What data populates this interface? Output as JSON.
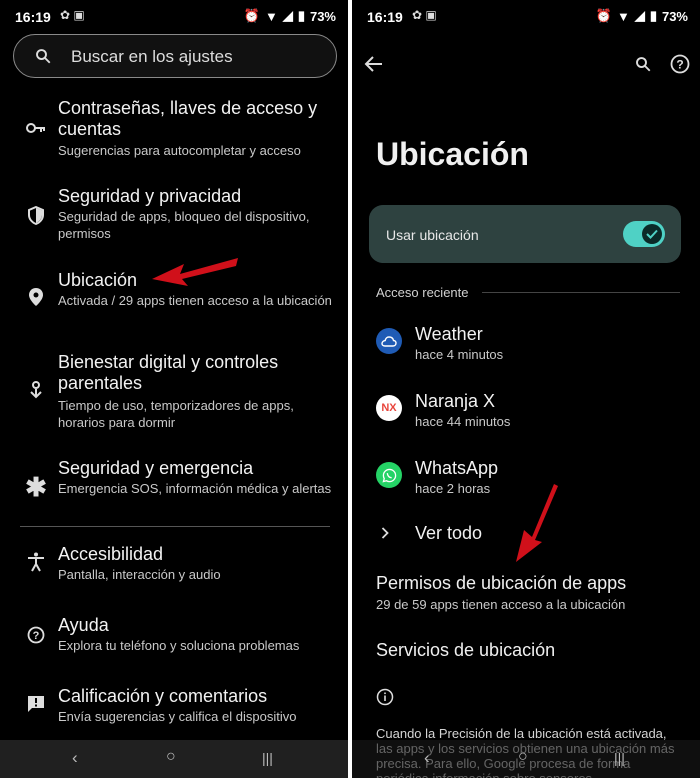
{
  "left": {
    "status": {
      "time": "16:19",
      "battery": "73%"
    },
    "search": {
      "placeholder": "Buscar en los ajustes"
    },
    "items": [
      {
        "title": "Contraseñas, llaves de acceso y cuentas",
        "subtitle": "Sugerencias para autocompletar y acceso",
        "icon": "key-icon"
      },
      {
        "title": "Seguridad y privacidad",
        "subtitle": "Seguridad de apps, bloqueo del dispositivo, permisos",
        "icon": "shield-icon"
      },
      {
        "title": "Ubicación",
        "subtitle": "Activada / 29 apps tienen acceso a la ubicación",
        "icon": "location-pin-icon"
      },
      {
        "title": "Bienestar digital y controles parentales",
        "subtitle": "Tiempo de uso, temporizadores de apps, horarios para dormir",
        "icon": "wellbeing-icon"
      },
      {
        "title": "Seguridad y emergencia",
        "subtitle": "Emergencia SOS, información médica y alertas",
        "icon": "asterisk-icon"
      },
      {
        "title": "Accesibilidad",
        "subtitle": "Pantalla, interacción y audio",
        "icon": "accessibility-icon"
      },
      {
        "title": "Ayuda",
        "subtitle": "Explora tu teléfono y soluciona problemas",
        "icon": "help-icon"
      },
      {
        "title": "Calificación y comentarios",
        "subtitle": "Envía sugerencias y califica el dispositivo",
        "icon": "feedback-icon"
      }
    ]
  },
  "right": {
    "status": {
      "time": "16:19",
      "battery": "73%"
    },
    "page_title": "Ubicación",
    "use_location": {
      "label": "Usar ubicación",
      "enabled": true
    },
    "recent_access_header": "Acceso reciente",
    "apps": [
      {
        "name": "Weather",
        "time": "hace 4 minutos",
        "icon": "weather-icon",
        "color": "#1f5bb5"
      },
      {
        "name": "Naranja X",
        "time": "hace 44 minutos",
        "icon": "naranja-x-icon",
        "color": "#ffffff"
      },
      {
        "name": "WhatsApp",
        "time": "hace 2 horas",
        "icon": "whatsapp-icon",
        "color": "#25d366"
      }
    ],
    "see_all": "Ver todo",
    "app_permissions": {
      "title": "Permisos de ubicación de apps",
      "subtitle": "29 de 59 apps tienen acceso a la ubicación"
    },
    "location_services": "Servicios de ubicación",
    "info_text": "Cuando la Precisión de la ubicación está activada, las apps y los servicios obtienen una ubicación más precisa. Para ello, Google procesa de forma periódica información sobre sensores"
  },
  "colors": {
    "accent": "#4fd1c5",
    "arrow": "#d0101a",
    "card": "#2e4240"
  }
}
